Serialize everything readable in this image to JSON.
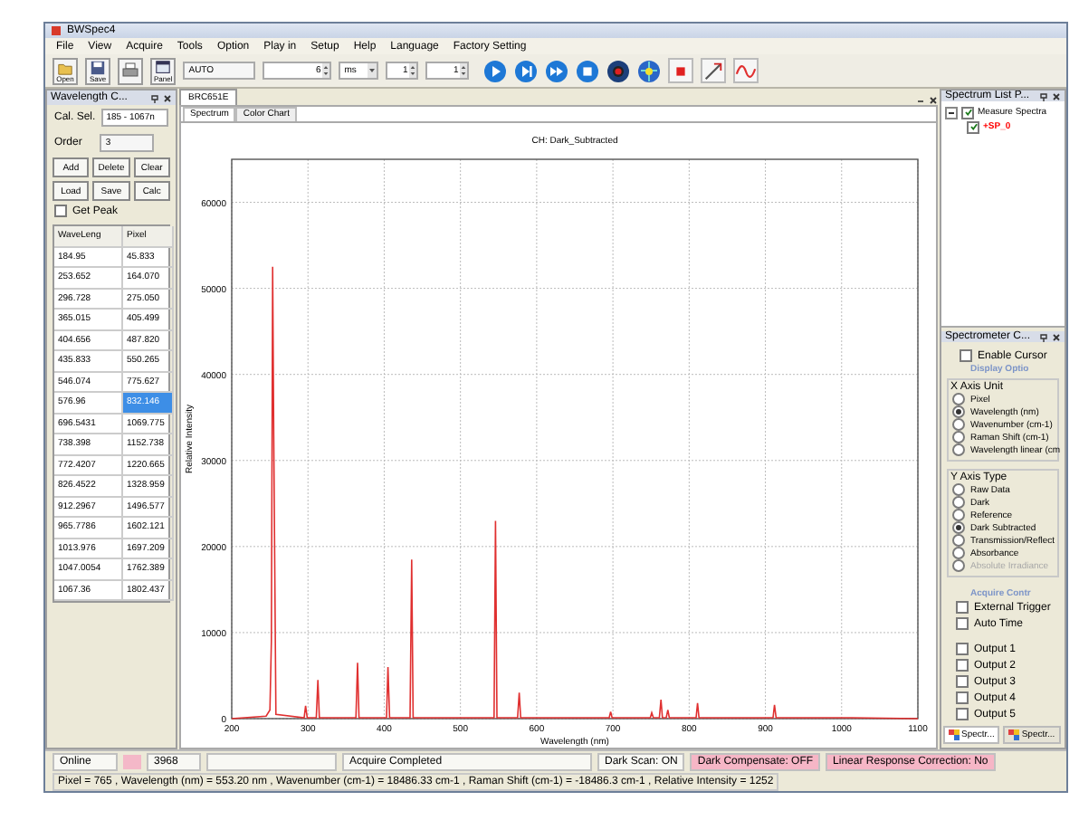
{
  "window": {
    "title": "BWSpec4"
  },
  "menu": [
    "File",
    "View",
    "Acquire",
    "Tools",
    "Option",
    "Play in",
    "Setup",
    "Help",
    "Language",
    "Factory Setting"
  ],
  "toolbar": {
    "buttons": [
      {
        "label": "Open",
        "kind": "folder"
      },
      {
        "label": "Save",
        "kind": "disk"
      },
      {
        "kind": "printer"
      },
      {
        "label": "Panel",
        "kind": "panel"
      }
    ],
    "mode_field": "AUTO",
    "integration": "6",
    "unit": "ms",
    "average": "1",
    "smoothing": "1",
    "actions": [
      {
        "kind": "play"
      },
      {
        "kind": "step"
      },
      {
        "kind": "forward"
      },
      {
        "kind": "stop"
      },
      {
        "kind": "record"
      },
      {
        "kind": "globe"
      },
      {
        "kind": "marker"
      },
      {
        "kind": "tool"
      },
      {
        "kind": "wave"
      }
    ]
  },
  "left_panel": {
    "title": "Wavelength C...",
    "cal_sel_label": "Cal. Sel.",
    "cal_sel_value": "185 - 1067n",
    "order_label": "Order",
    "order_value": "3",
    "buttons": [
      "Add",
      "Delete",
      "Clear",
      "Load",
      "Save",
      "Calc"
    ],
    "get_peak": {
      "label": "Get Peak",
      "checked": false
    },
    "table": {
      "columns": [
        "WaveLeng",
        "Pixel"
      ],
      "rows": [
        {
          "cells": [
            "184.95",
            "45.833"
          ],
          "selected": false
        },
        {
          "cells": [
            "253.652",
            "164.070"
          ],
          "selected": false
        },
        {
          "cells": [
            "296.728",
            "275.050"
          ],
          "selected": false
        },
        {
          "cells": [
            "365.015",
            "405.499"
          ],
          "selected": false
        },
        {
          "cells": [
            "404.656",
            "487.820"
          ],
          "selected": false
        },
        {
          "cells": [
            "435.833",
            "550.265"
          ],
          "selected": false
        },
        {
          "cells": [
            "546.074",
            "775.627"
          ],
          "selected": false
        },
        {
          "cells": [
            "576.96",
            "832.146"
          ],
          "selected": true
        },
        {
          "cells": [
            "696.5431",
            "1069.775"
          ],
          "selected": false
        },
        {
          "cells": [
            "738.398",
            "1152.738"
          ],
          "selected": false
        },
        {
          "cells": [
            "772.4207",
            "1220.665"
          ],
          "selected": false
        },
        {
          "cells": [
            "826.4522",
            "1328.959"
          ],
          "selected": false
        },
        {
          "cells": [
            "912.2967",
            "1496.577"
          ],
          "selected": false
        },
        {
          "cells": [
            "965.7786",
            "1602.121"
          ],
          "selected": false
        },
        {
          "cells": [
            "1013.976",
            "1697.209"
          ],
          "selected": false
        },
        {
          "cells": [
            "1047.0054",
            "1762.389"
          ],
          "selected": false
        },
        {
          "cells": [
            "1067.36",
            "1802.437"
          ],
          "selected": false
        }
      ]
    }
  },
  "document": {
    "tab": "BRC651E",
    "subtabs": [
      {
        "label": "Spectrum",
        "selected": true
      },
      {
        "label": "Color Chart",
        "selected": false
      }
    ],
    "chart_data": {
      "type": "line",
      "title": "CH: Dark_Subtracted",
      "xlabel": "Wavelength (nm)",
      "ylabel": "Relative Intensity",
      "x": [
        200,
        245,
        250,
        252,
        253.7,
        255,
        258,
        295,
        297,
        299,
        311,
        313,
        315,
        363,
        365,
        367,
        403,
        405,
        407,
        434,
        436,
        438,
        544,
        546,
        548,
        575,
        577,
        579,
        695,
        697,
        699,
        749,
        751,
        753,
        761,
        763,
        765,
        770,
        772,
        774,
        809,
        811,
        813,
        910,
        912,
        914,
        1013,
        1100
      ],
      "series": [
        {
          "color": "#e03030",
          "values": [
            0,
            300,
            1000,
            9000,
            52500,
            33000,
            500,
            100,
            1500,
            100,
            100,
            4500,
            100,
            100,
            6500,
            100,
            100,
            6000,
            100,
            100,
            18500,
            100,
            100,
            23000,
            100,
            100,
            3000,
            100,
            100,
            800,
            100,
            100,
            700,
            100,
            100,
            2200,
            100,
            100,
            1000,
            100,
            100,
            1800,
            100,
            100,
            1600,
            100,
            100,
            0
          ]
        }
      ],
      "grid": true,
      "xlim": [
        200,
        1100
      ],
      "ylim": [
        0,
        65000
      ],
      "xticks": [
        200,
        300,
        400,
        500,
        600,
        700,
        800,
        900,
        1000,
        1100
      ],
      "yticks": [
        0,
        10000,
        20000,
        30000,
        40000,
        50000,
        60000
      ]
    }
  },
  "spectrum_list": {
    "title": "Spectrum List P...",
    "tree": [
      {
        "label": "Measure Spectra",
        "checked": true,
        "expanded": true,
        "children": [
          {
            "label": "+SP_0",
            "checked": true,
            "color": "#ff0000"
          }
        ]
      }
    ]
  },
  "spectrometer": {
    "title": "Spectrometer C...",
    "enable_cursor": {
      "label": "Enable Cursor",
      "checked": false
    },
    "display_heading": "Display Optio",
    "x_axis": {
      "title": "X Axis Unit",
      "options": [
        {
          "label": "Pixel",
          "selected": false
        },
        {
          "label": "Wavelength (nm)",
          "selected": true
        },
        {
          "label": "Wavenumber (cm-1)",
          "selected": false
        },
        {
          "label": "Raman Shift (cm-1)",
          "selected": false
        },
        {
          "label": "Wavelength linear (cm",
          "selected": false
        }
      ]
    },
    "y_axis": {
      "title": "Y Axis Type",
      "options": [
        {
          "label": "Raw Data",
          "selected": false,
          "disabled": false
        },
        {
          "label": "Dark",
          "selected": false,
          "disabled": false
        },
        {
          "label": "Reference",
          "selected": false,
          "disabled": false
        },
        {
          "label": "Dark Subtracted",
          "selected": true,
          "disabled": false
        },
        {
          "label": "Transmission/Reflect",
          "selected": false,
          "disabled": false
        },
        {
          "label": "Absorbance",
          "selected": false,
          "disabled": false
        },
        {
          "label": "Absolute Irradiance",
          "selected": false,
          "disabled": true
        }
      ]
    },
    "acquire_heading": "Acquire Contr",
    "triggers": [
      {
        "label": "External Trigger",
        "checked": false
      },
      {
        "label": "Auto Time",
        "checked": false
      }
    ],
    "outputs": [
      {
        "label": "Output 1",
        "checked": false
      },
      {
        "label": "Output 2",
        "checked": false
      },
      {
        "label": "Output 3",
        "checked": false
      },
      {
        "label": "Output 4",
        "checked": false
      },
      {
        "label": "Output 5",
        "checked": false
      }
    ]
  },
  "panel_tabs": [
    {
      "label": "Spectr...",
      "selected": true
    },
    {
      "label": "Spectr...",
      "selected": false
    }
  ],
  "status_bar": {
    "connection": "Online",
    "count": "3968",
    "progress": {
      "level": 0
    },
    "message": "Acquire Completed",
    "flags": [
      {
        "text": "Dark Scan: ON",
        "alert": false
      },
      {
        "text": "Dark Compensate: OFF",
        "alert": true
      },
      {
        "text": "Linear Response Correction: No",
        "alert": true
      }
    ],
    "readout": "Pixel = 765 , Wavelength (nm) = 553.20 nm , Wavenumber (cm-1) = 18486.33 cm-1 , Raman Shift (cm-1) = -18486.3 cm-1 , Relative Intensity = 1252"
  }
}
